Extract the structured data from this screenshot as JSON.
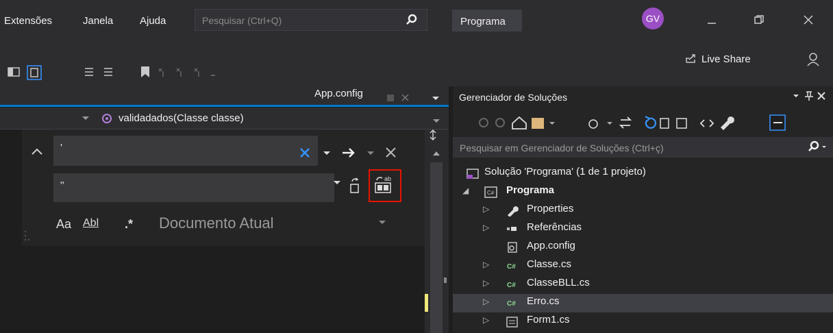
{
  "menu": {
    "items": [
      "Extensões",
      "Janela",
      "Ajuda"
    ],
    "search_placeholder": "Pesquisar (Ctrl+Q)",
    "solution_name": "Programa",
    "avatar_initials": "GV"
  },
  "toolbar": {
    "live_share": "Live Share"
  },
  "editor": {
    "tab_label": "App.config",
    "member_dropdown": "validadados(Classe classe)",
    "find": {
      "find_value": "'",
      "replace_value": "\"",
      "match_case": "Aa",
      "match_word": "Abl",
      "regex": ".*",
      "scope": "Documento Atual"
    }
  },
  "solution_explorer": {
    "title": "Gerenciador de Soluções",
    "search_placeholder": "Pesquisar em Gerenciador de Soluções (Ctrl+ç)",
    "solution_label": "Solução 'Programa' (1 de 1 projeto)",
    "project_label": "Programa",
    "items": [
      {
        "label": "Properties",
        "icon": "wrench-icon"
      },
      {
        "label": "Referências",
        "icon": "references-icon"
      },
      {
        "label": "App.config",
        "icon": "config-file-icon"
      },
      {
        "label": "Classe.cs",
        "icon": "csharp-file-icon"
      },
      {
        "label": "ClasseBLL.cs",
        "icon": "csharp-file-icon"
      },
      {
        "label": "Erro.cs",
        "icon": "csharp-file-icon"
      },
      {
        "label": "Form1.cs",
        "icon": "form-icon"
      }
    ]
  },
  "colors": {
    "accent": "#007acc",
    "highlight_box": "#e51400",
    "avatar": "#9b4fc4"
  }
}
